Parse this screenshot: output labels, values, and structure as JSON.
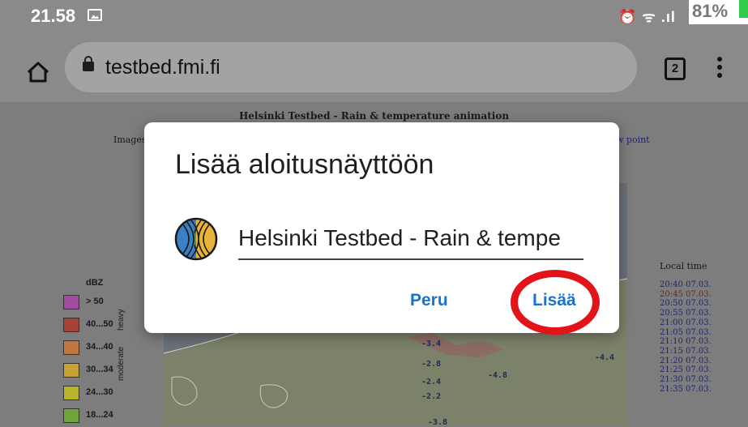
{
  "status_bar": {
    "time": "21.58",
    "icons": "⏰ ᯤ .ıl",
    "battery": "81%"
  },
  "browser": {
    "url": "testbed.fmi.fi",
    "tab_count": "2"
  },
  "page": {
    "title": "Helsinki Testbed - Rain & temperature animation",
    "images_label": "Images",
    "viewpoint_link": "w point",
    "legend": {
      "title": "dBZ",
      "items": [
        {
          "label": "> 50",
          "color": "#a04aa0"
        },
        {
          "label": "40...50",
          "color": "#a8413a"
        },
        {
          "label": "34...40",
          "color": "#c2773e"
        },
        {
          "label": "30...34",
          "color": "#c9a033"
        },
        {
          "label": "24...30",
          "color": "#b8b42c"
        },
        {
          "label": "18...24",
          "color": "#6ea63c"
        }
      ],
      "side_heavy": "heavy",
      "side_moderate": "moderate"
    },
    "map_labels": [
      "-3.4",
      "-2.8",
      "-2.4",
      "-4.8",
      "-2.2",
      "-4.4",
      "-3.8"
    ],
    "times_header": "Local time",
    "times": [
      "20:40 07.03.",
      "20:45 07.03.",
      "20:50 07.03.",
      "20:55 07.03.",
      "21:00 07.03.",
      "21:05 07.03.",
      "21:10 07.03.",
      "21:15 07.03.",
      "21:20 07.03.",
      "21:25 07.03.",
      "21:30 07.03.",
      "21:35 07.03."
    ],
    "current_time_index": 1
  },
  "dialog": {
    "title": "Lisää aloitusnäyttöön",
    "input_value": "Helsinki Testbed - Rain & tempe",
    "cancel_label": "Peru",
    "add_label": "Lisää"
  },
  "colors": {
    "accent": "#1a73c8",
    "highlight": "#e3131a",
    "scrim": "#7d7d7d"
  }
}
